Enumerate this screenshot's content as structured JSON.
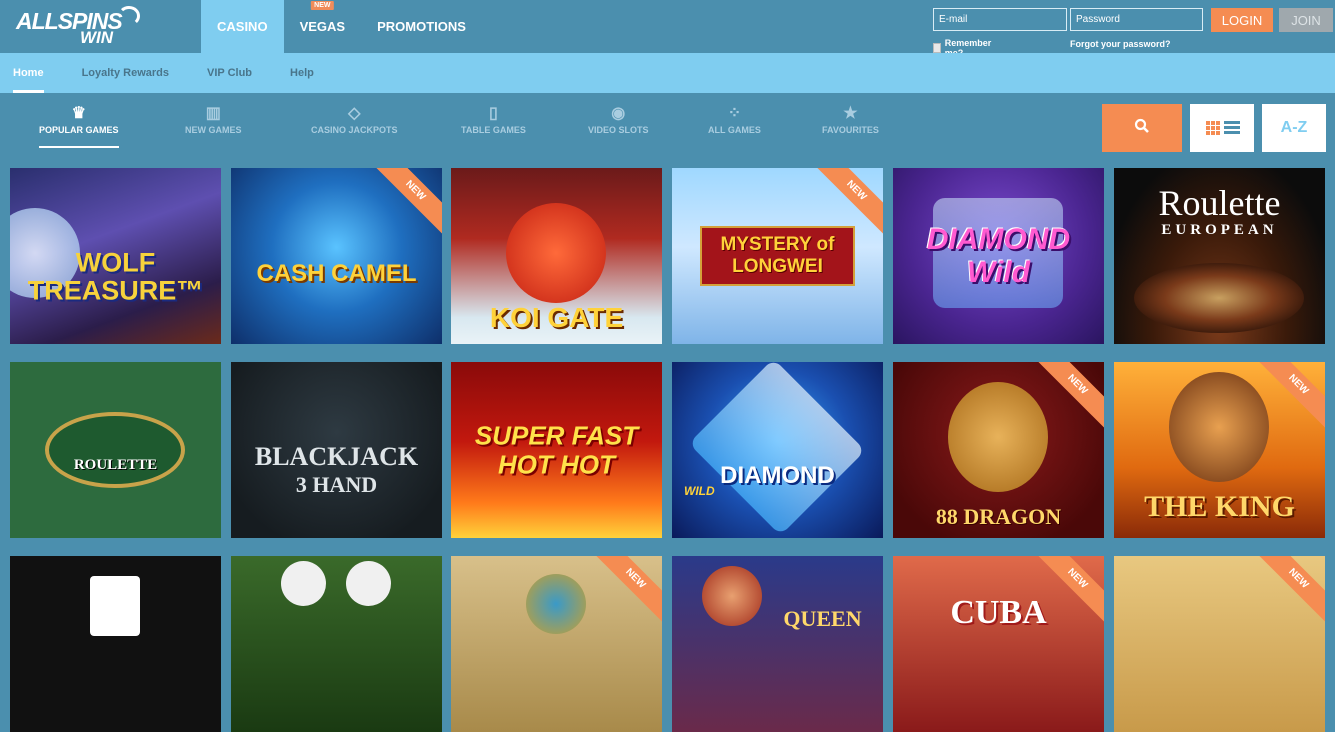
{
  "brand": {
    "logo_line1": "ALLSPINS",
    "logo_line2": "WIN"
  },
  "main_nav": [
    {
      "label": "CASINO",
      "active": true
    },
    {
      "label": "VEGAS",
      "badge": "NEW"
    },
    {
      "label": "PROMOTIONS"
    }
  ],
  "auth": {
    "email_placeholder": "E-mail",
    "password_placeholder": "Password",
    "login_label": "LOGIN",
    "join_label": "JOIN",
    "remember_label": "Remember me?",
    "forgot_label": "Forgot your password?"
  },
  "sub_nav": [
    {
      "label": "Home",
      "active": true
    },
    {
      "label": "Loyalty Rewards"
    },
    {
      "label": "VIP Club"
    },
    {
      "label": "Help"
    }
  ],
  "categories": [
    {
      "label": "POPULAR GAMES",
      "icon": "crown-icon",
      "active": true
    },
    {
      "label": "NEW GAMES",
      "icon": "slot-machine-icon"
    },
    {
      "label": "CASINO JACKPOTS",
      "icon": "diamond-icon"
    },
    {
      "label": "TABLE GAMES",
      "icon": "cards-icon"
    },
    {
      "label": "VIDEO SLOTS",
      "icon": "chip-icon"
    },
    {
      "label": "ALL GAMES",
      "icon": "dice-icon"
    },
    {
      "label": "FAVOURITES",
      "icon": "star-icon"
    }
  ],
  "toolbar": {
    "az_label": "A-Z"
  },
  "new_badge": "NEW",
  "colors": {
    "header": "#4b8fae",
    "subnav": "#7fcdf0",
    "accent": "#f58c52"
  },
  "games": [
    {
      "title": "WOLF TREASURE™",
      "new": false
    },
    {
      "title": "CASH CAMEL",
      "new": true
    },
    {
      "title": "KOI GATE",
      "new": false
    },
    {
      "title": "MYSTERY of LONGWEI",
      "new": true
    },
    {
      "title": "DIAMOND Wild",
      "new": false
    },
    {
      "title": "Roulette",
      "subtitle": "EUROPEAN",
      "new": false
    },
    {
      "title": "ROULETTE",
      "new": false
    },
    {
      "title": "BLACKJACK",
      "subtitle": "3 HAND",
      "new": false
    },
    {
      "title": "SUPER FAST HOT HOT",
      "new": false
    },
    {
      "title": "DIAMOND",
      "subtitle": "WILD",
      "new": false
    },
    {
      "title": "88 DRAGON",
      "new": true
    },
    {
      "title": "THE KING",
      "new": true
    },
    {
      "title": "",
      "new": false
    },
    {
      "title": "",
      "new": false
    },
    {
      "title": "",
      "new": true
    },
    {
      "title": "QUEEN",
      "new": false
    },
    {
      "title": "CUBA",
      "new": true
    },
    {
      "title": "",
      "new": true
    }
  ]
}
